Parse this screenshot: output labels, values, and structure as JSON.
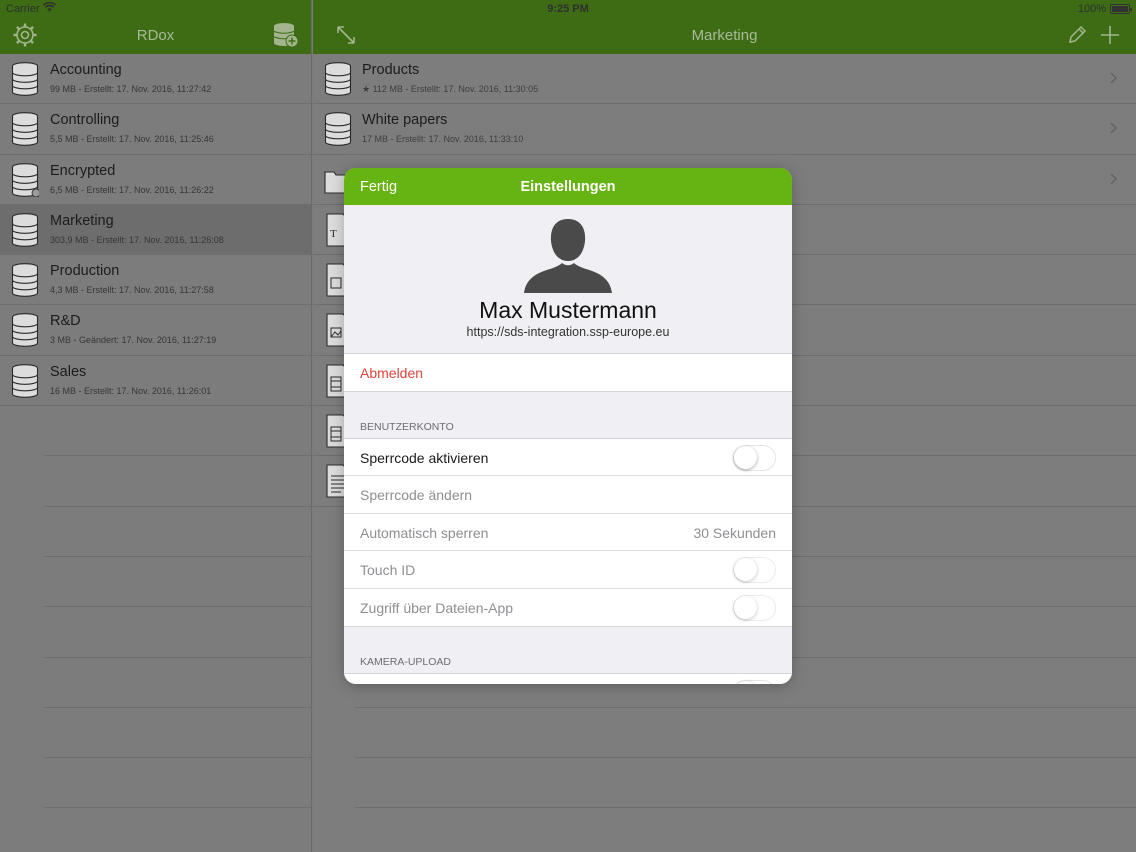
{
  "status_bar": {
    "carrier": "Carrier",
    "time": "9:25 PM",
    "battery": "100%"
  },
  "left_pane": {
    "title": "RDox",
    "icons": {
      "settings": "gear-icon",
      "add_room": "add-database-icon"
    },
    "rooms": [
      {
        "name": "Accounting",
        "meta": "99 MB - Erstellt: 17. Nov. 2016, 11:27:42"
      },
      {
        "name": "Controlling",
        "meta": "5,5 MB - Erstellt: 17. Nov. 2016, 11:25:46"
      },
      {
        "name": "Encrypted",
        "meta": "6,5 MB - Erstellt: 17. Nov. 2016, 11:26:22"
      },
      {
        "name": "Marketing",
        "meta": "303,9 MB - Erstellt: 17. Nov. 2016, 11:26:08",
        "selected": true
      },
      {
        "name": "Production",
        "meta": "4,3 MB - Erstellt: 17. Nov. 2016, 11:27:58"
      },
      {
        "name": "R&D",
        "meta": "3 MB - Geändert: 17. Nov. 2016, 11:27:19"
      },
      {
        "name": "Sales",
        "meta": "16 MB - Erstellt: 17. Nov. 2016, 11:26:01"
      }
    ]
  },
  "right_pane": {
    "title": "Marketing",
    "icons": {
      "expand": "expand-icon",
      "edit": "pencil-icon",
      "add": "plus-icon"
    },
    "items": [
      {
        "name": "Products",
        "meta": "★ 112 MB - Erstellt: 17. Nov. 2016, 11:30:05",
        "icon": "database-icon"
      },
      {
        "name": "White papers",
        "meta": "17 MB - Erstellt: 17. Nov. 2016, 11:33:10",
        "icon": "database-icon"
      }
    ]
  },
  "modal": {
    "done_label": "Fertig",
    "title": "Einstellungen",
    "user_name": "Max Mustermann",
    "server_url": "https://sds-integration.ssp-europe.eu",
    "logout_label": "Abmelden",
    "account_section": {
      "header": "BENUTZERKONTO",
      "passcode_enable": {
        "label": "Sperrcode aktivieren",
        "on": false
      },
      "passcode_change": {
        "label": "Sperrcode ändern"
      },
      "auto_lock": {
        "label": "Automatisch sperren",
        "value": "30 Sekunden"
      },
      "touch_id": {
        "label": "Touch ID",
        "on": false
      },
      "files_app": {
        "label": "Zugriff über Dateien-App",
        "on": false
      }
    },
    "camera_section": {
      "header": "KAMERA-UPLOAD"
    }
  },
  "colors": {
    "nav_green": "#66b412",
    "dimmed_nav_green": "#3d6c14",
    "logout_red": "#e0433a"
  }
}
